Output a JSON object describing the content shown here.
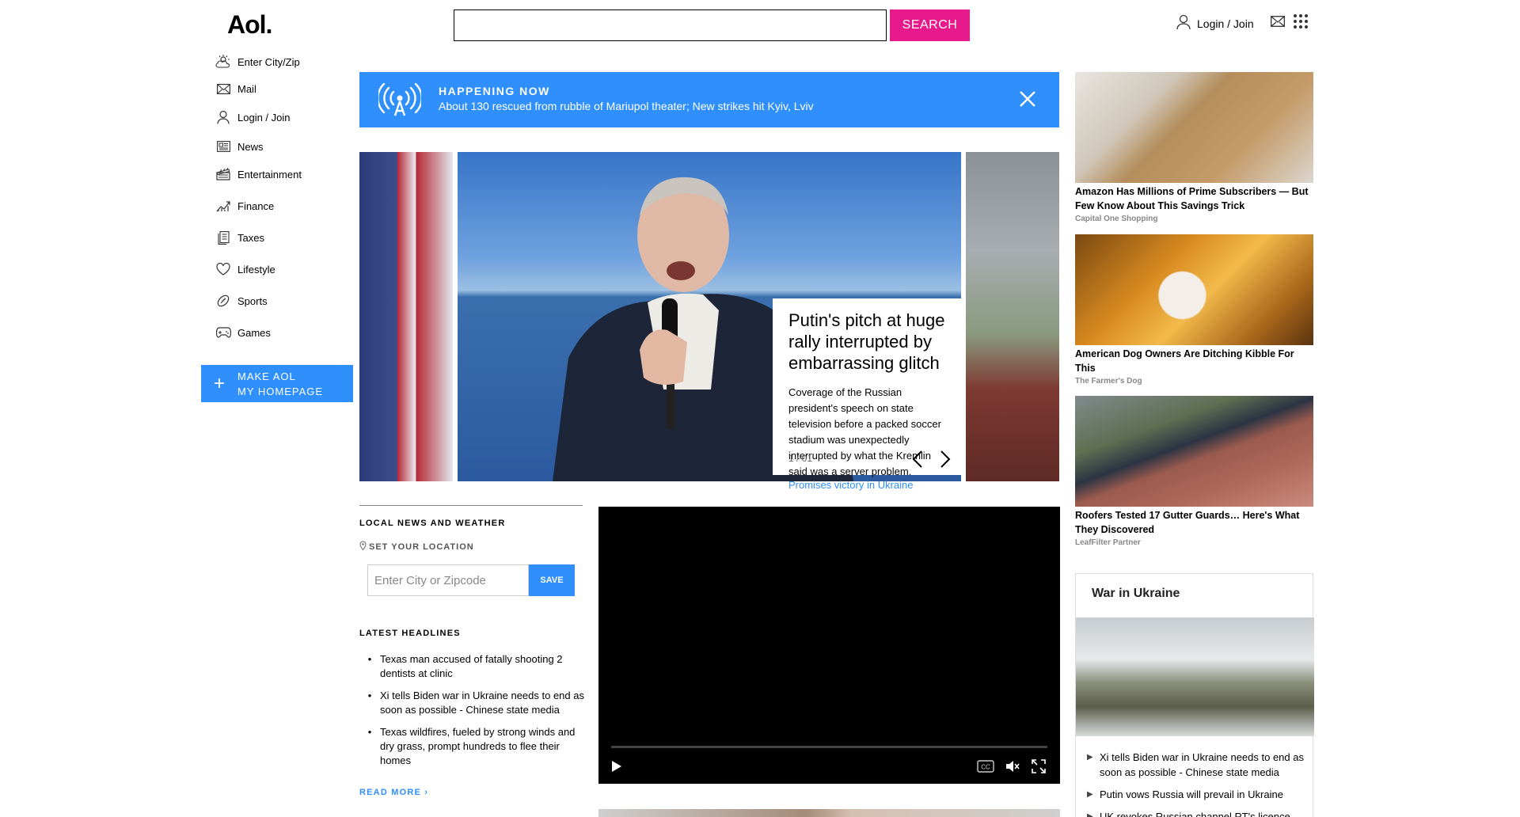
{
  "header": {
    "logo": "Aol.",
    "search_placeholder": "",
    "search_label": "SEARCH",
    "login_label": "Login / Join"
  },
  "nav": {
    "items": [
      {
        "label": "Enter City/Zip",
        "icon": "weather-icon"
      },
      {
        "label": "Mail",
        "icon": "mail-icon"
      },
      {
        "label": "Login / Join",
        "icon": "user-icon"
      },
      {
        "label": "News",
        "icon": "news-icon"
      },
      {
        "label": "Entertainment",
        "icon": "clapperboard-icon"
      },
      {
        "label": "Finance",
        "icon": "chart-icon"
      },
      {
        "label": "Taxes",
        "icon": "document-icon"
      },
      {
        "label": "Lifestyle",
        "icon": "heart-icon"
      },
      {
        "label": "Sports",
        "icon": "football-icon"
      },
      {
        "label": "Games",
        "icon": "gamepad-icon"
      }
    ],
    "make_home_line1": "MAKE AOL",
    "make_home_line2": "MY HOMEPAGE"
  },
  "happening": {
    "title": "HAPPENING NOW",
    "text": "About 130 rescued from rubble of Mariupol theater; New strikes hit Kyiv, Lviv"
  },
  "hero": {
    "title": "Putin's pitch at huge rally interrupted by embarrassing glitch",
    "description": "Coverage of the Russian president's speech on state television before a packed soccer stadium was unexpectedly interrupted by what the Kremlin said was a server problem.",
    "counter": "1 / 01",
    "next_link": "Promises victory in Ukraine"
  },
  "local": {
    "title": "LOCAL NEWS AND WEATHER",
    "set_location": "SET YOUR LOCATION",
    "zip_placeholder": "Enter City or Zipcode",
    "save_label": "SAVE"
  },
  "headlines": {
    "title": "LATEST HEADLINES",
    "items": [
      "Texas man accused of fatally shooting 2 dentists at clinic",
      "Xi tells Biden war in Ukraine needs to end as soon as possible - Chinese state media",
      "Texas wildfires, fueled by strong winds and dry grass, prompt hundreds to flee their homes"
    ],
    "read_more": "READ MORE ›"
  },
  "ads": [
    {
      "title": "Amazon Has Millions of Prime Subscribers — But Few Know About This Savings Trick",
      "source": "Capital One Shopping"
    },
    {
      "title": "American Dog Owners Are Ditching Kibble For This",
      "source": "The Farmer's Dog"
    },
    {
      "title": "Roofers Tested 17 Gutter Guards… Here's What They Discovered",
      "source": "LeafFilter Partner"
    }
  ],
  "ukraine": {
    "title": "War in Ukraine",
    "items": [
      "Xi tells Biden war in Ukraine needs to end as soon as possible - Chinese state media",
      "Putin vows Russia will prevail in Ukraine",
      "UK revokes Russian channel RT's licence"
    ]
  },
  "colors": {
    "accent_blue": "#2e8ffd",
    "search_pink": "#e8198b"
  }
}
